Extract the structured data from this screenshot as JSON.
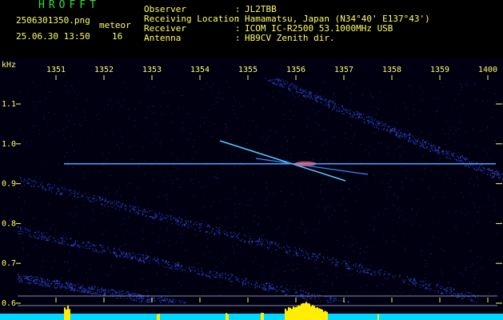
{
  "header": {
    "app_name": "HROFFT",
    "filename": "2506301350.png",
    "datetime": "25.06.30 13:50",
    "count_label": "meteor",
    "count_value": "16",
    "fields": [
      {
        "label": "Observer",
        "value": "JL2TBB"
      },
      {
        "label": "Receiving Location",
        "value": "Hamamatsu, Japan (N34°40' E137°43')"
      },
      {
        "label": "Receiver",
        "value": "ICOM IC-R2500 53.1000MHz USB"
      },
      {
        "label": "Antenna",
        "value": "HB9CV Zenith dir."
      }
    ],
    "separator": ":"
  },
  "spectrogram": {
    "y_unit": "kHz",
    "x_ticks": [
      "1351",
      "1352",
      "1353",
      "1354",
      "1355",
      "1356",
      "1357",
      "1358",
      "1359",
      "1400"
    ],
    "y_ticks": [
      "1.1",
      "1.0",
      "0.9",
      "0.8",
      "0.7",
      "0.6"
    ],
    "carrier_khz": 0.95,
    "colors": {
      "background": "#000010",
      "axis_text": "#ffff66",
      "tick_marks": "#ffff66",
      "carrier": "#4da6ff",
      "echo": "#55ccff",
      "noise_band": "#2233aa",
      "level_bar": "#00d8ff",
      "level_peak": "#ffee00"
    }
  }
}
